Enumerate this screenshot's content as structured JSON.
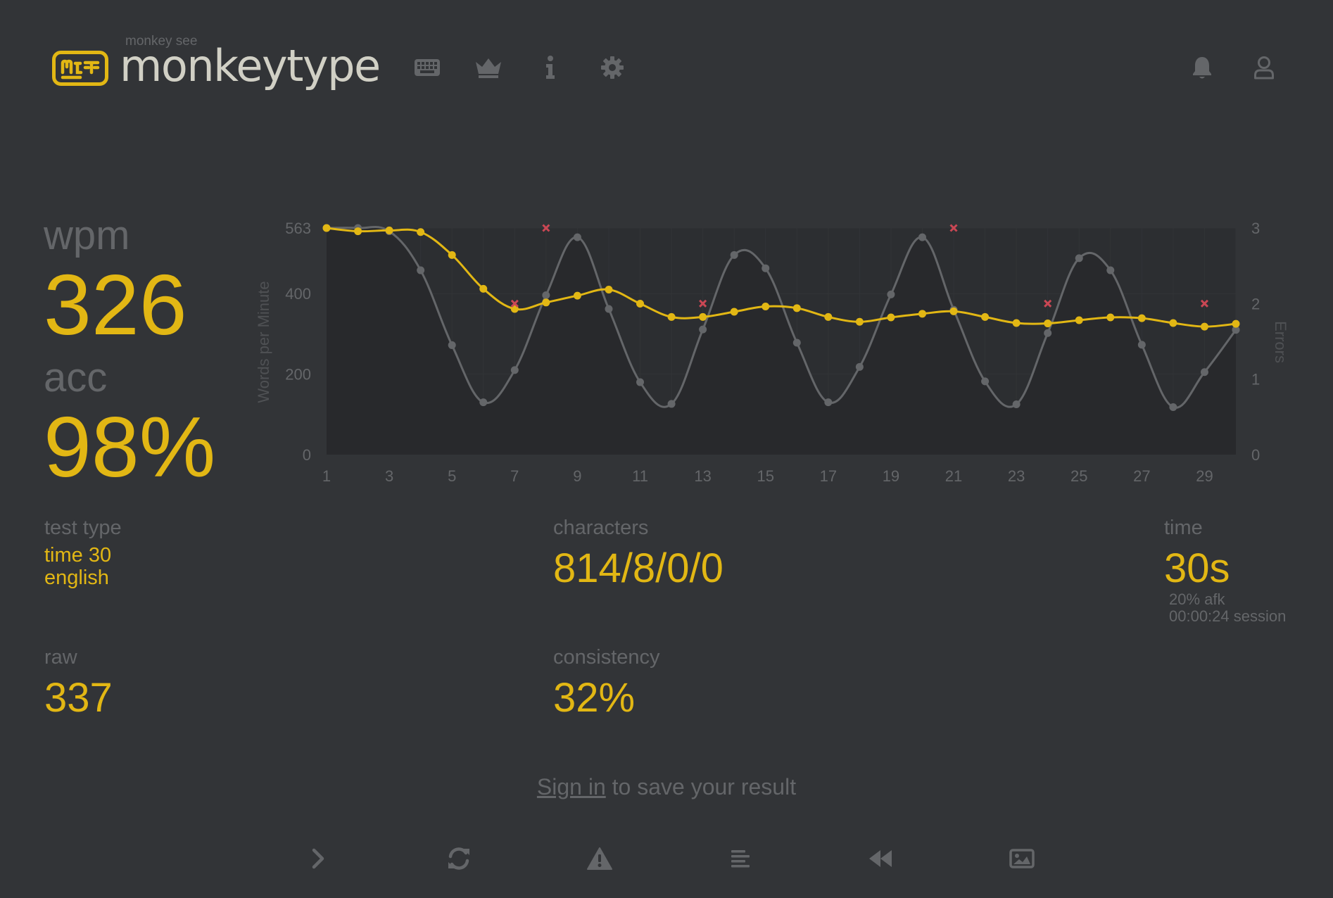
{
  "header": {
    "top_text": "monkey see",
    "brand": "monkeytype",
    "nav_icons": [
      "keyboard-icon",
      "crown-icon",
      "info-icon",
      "gear-icon"
    ],
    "right_icons": [
      "bell-icon",
      "user-icon"
    ]
  },
  "stats": {
    "wpm_label": "wpm",
    "wpm_value": "326",
    "acc_label": "acc",
    "acc_value": "98%",
    "test_type_label": "test type",
    "test_type_mode": "time 30",
    "test_type_language": "english",
    "raw_label": "raw",
    "raw_value": "337",
    "characters_label": "characters",
    "characters_value": "814/8/0/0",
    "consistency_label": "consistency",
    "consistency_value": "32%",
    "time_label": "time",
    "time_value": "30s",
    "afk": "20% afk",
    "session": "00:00:24 session"
  },
  "signin": {
    "link": "Sign in",
    "text": " to save your result"
  },
  "bottom_icons": [
    "next-test-icon",
    "restart-icon",
    "report-icon",
    "word-history-icon",
    "replay-icon",
    "screenshot-icon"
  ],
  "colors": {
    "background": "#323437",
    "main": "#e2b714",
    "sub": "#646669",
    "text": "#d1d0c5",
    "error": "#ca4754"
  },
  "chart_data": {
    "type": "line",
    "ylabel": "Words per Minute",
    "y2label": "Errors",
    "x": [
      1,
      2,
      3,
      4,
      5,
      6,
      7,
      8,
      9,
      10,
      11,
      12,
      13,
      14,
      15,
      16,
      17,
      18,
      19,
      20,
      21,
      22,
      23,
      24,
      25,
      26,
      27,
      28,
      29,
      30
    ],
    "x_ticks": [
      1,
      3,
      5,
      7,
      9,
      11,
      13,
      15,
      17,
      19,
      21,
      23,
      25,
      27,
      29
    ],
    "ylim": [
      0,
      563
    ],
    "y_ticks": [
      0,
      200,
      400,
      563
    ],
    "y2lim": [
      0,
      3
    ],
    "y2_ticks": [
      0,
      1,
      2,
      3
    ],
    "grid": true,
    "series": [
      {
        "name": "raw",
        "color": "#646669",
        "values": [
          563,
          563,
          555,
          458,
          272,
          130,
          210,
          396,
          540,
          362,
          180,
          126,
          311,
          496,
          463,
          278,
          130,
          218,
          398,
          540,
          360,
          182,
          125,
          302,
          488,
          458,
          273,
          118,
          205,
          310
        ]
      },
      {
        "name": "wpm",
        "color": "#e2b714",
        "values": [
          563,
          555,
          557,
          553,
          496,
          412,
          362,
          378,
          395,
          410,
          375,
          342,
          342,
          355,
          368,
          364,
          342,
          330,
          341,
          350,
          356,
          342,
          327,
          326,
          334,
          341,
          339,
          327,
          318,
          325
        ]
      },
      {
        "name": "errors",
        "color": "#ca4754",
        "x": [
          7,
          8,
          13,
          21,
          24,
          29
        ],
        "values": [
          2,
          3,
          2,
          3,
          2,
          2
        ]
      }
    ]
  }
}
